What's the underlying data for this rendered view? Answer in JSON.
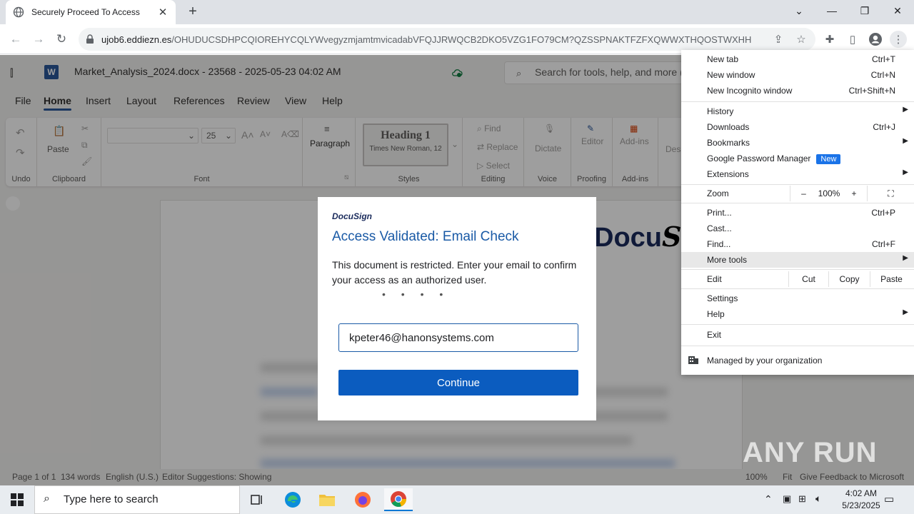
{
  "browser": {
    "tab_title": "Securely Proceed To Access",
    "url_host": "ujob6.eddiezn.es",
    "url_path": "/OHUDUCSDHPCQIOREHYCQLYWvegyzmjamtmvicadabVFQJJRWQCB2DKO5VZG1FO79CM?QZSSPNAKTFZFXQWWXTHQOSTWXHH"
  },
  "word": {
    "doc_title": "Market_Analysis_2024.docx - 23568 - 2025-05-23 04:02 AM",
    "search_placeholder": "Search for tools, help, and more (",
    "tabs": [
      "File",
      "Home",
      "Insert",
      "Layout",
      "References",
      "Review",
      "View",
      "Help"
    ],
    "ribbon": {
      "undo_label": "Undo",
      "paste_label": "Paste",
      "clipboard_label": "Clipboard",
      "font_size": "25",
      "font_label": "Font",
      "paragraph_label": "Paragraph",
      "heading_label": "Heading 1",
      "heading_font": "Times New Roman, 12",
      "styles_label": "Styles",
      "find_label": "Find",
      "replace_label": "Replace",
      "select_label": "Select",
      "editing_label": "Editing",
      "dictate_label": "Dictate",
      "voice_label": "Voice",
      "editor_label": "Editor",
      "proofing_label": "Proofing",
      "addins_label": "Add-ins",
      "addins_group_label": "Add-ins",
      "designer_label": "Desi"
    },
    "status": {
      "page": "Page 1 of 1",
      "words": "134 words",
      "language": "English (U.S.)",
      "editor": "Editor Suggestions: Showing",
      "zoom": "100%",
      "fit": "Fit",
      "feedback": "Give Feedback to Microsoft"
    },
    "bg_logo_docu": "Docu",
    "bg_logo_sign": "Sig"
  },
  "modal": {
    "brand": "DocuSign",
    "heading": "Access Validated: Email Check",
    "description": "This document is restricted. Enter your email to confirm your access as an authorized user.",
    "dots": "• • • •",
    "email_value": "kpeter46@hanonsystems.com",
    "continue_label": "Continue"
  },
  "chrome_menu": {
    "new_tab": "New tab",
    "new_tab_sc": "Ctrl+T",
    "new_window": "New window",
    "new_window_sc": "Ctrl+N",
    "new_incognito": "New Incognito window",
    "new_incognito_sc": "Ctrl+Shift+N",
    "history": "History",
    "downloads": "Downloads",
    "downloads_sc": "Ctrl+J",
    "bookmarks": "Bookmarks",
    "password_manager": "Google Password Manager",
    "new_badge": "New",
    "extensions": "Extensions",
    "zoom": "Zoom",
    "zoom_minus": "–",
    "zoom_value": "100%",
    "zoom_plus": "+",
    "print": "Print...",
    "print_sc": "Ctrl+P",
    "cast": "Cast...",
    "find": "Find...",
    "find_sc": "Ctrl+F",
    "more_tools": "More tools",
    "edit": "Edit",
    "cut": "Cut",
    "copy": "Copy",
    "paste": "Paste",
    "settings": "Settings",
    "help": "Help",
    "exit": "Exit",
    "managed": "Managed by your organization"
  },
  "taskbar": {
    "search_placeholder": "Type here to search",
    "time": "4:02 AM",
    "date": "5/23/2025"
  },
  "watermark": "ANY RUN",
  "colors": {
    "accent_word": "#2b579a",
    "docusign_blue": "#1a5aa6",
    "continue_button": "#0b5cbf",
    "chrome_badge": "#1a73e8"
  }
}
